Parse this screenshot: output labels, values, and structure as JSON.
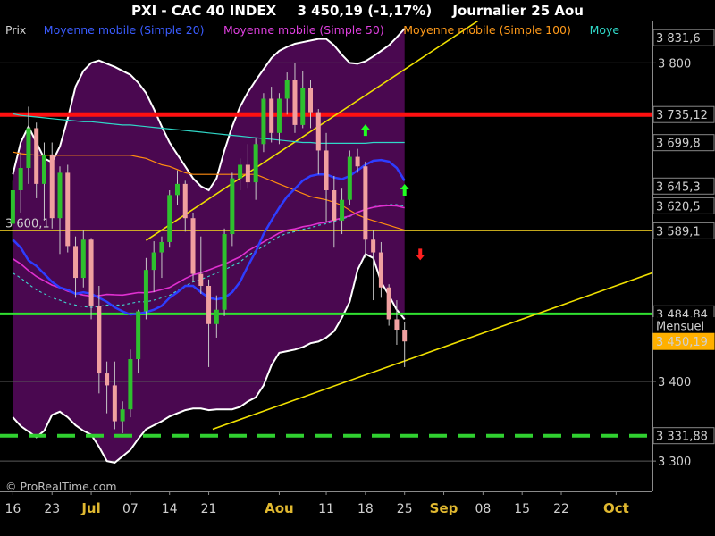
{
  "header": {
    "symbol": "PXI - CAC 40 INDEX",
    "last": "3 450,19 (-1,17%)",
    "period": "Journalier  25 Aou"
  },
  "legend": [
    {
      "label": "Prix",
      "color": "#cfcfcf"
    },
    {
      "label": "Moyenne mobile (Simple 20)",
      "color": "#3a5cff"
    },
    {
      "label": "Moyenne mobile (Simple 50)",
      "color": "#e040e0"
    },
    {
      "label": "Moyenne mobile (Simple 100)",
      "color": "#ff9a1a"
    },
    {
      "label": "Moye",
      "color": "#30d8c8"
    }
  ],
  "watermark": "© ProRealTime.com",
  "colors": {
    "up": "#2ec02e",
    "down": "#f0a0a0",
    "band_fill": "#4a0850",
    "band_line": "#ffffff",
    "resistance": "#ff1010",
    "support": "#30e030",
    "channel": "#f0e000",
    "sma20": "#2e3dff",
    "sma50": "#e030d0",
    "sma100": "#ff8c10",
    "sma200": "#30d8c8"
  },
  "chart_data": {
    "type": "candlestick",
    "instrument": "PXI - CAC 40 INDEX",
    "timeframe": "Journalier",
    "y_range": [
      3262,
      3852
    ],
    "y_ticks": [
      3300,
      3400,
      3800
    ],
    "x_tick_labels": [
      {
        "label": "16",
        "i": 0
      },
      {
        "label": "23",
        "i": 5
      },
      {
        "label": "Jul",
        "i": 10,
        "bold": true
      },
      {
        "label": "07",
        "i": 15
      },
      {
        "label": "14",
        "i": 20
      },
      {
        "label": "21",
        "i": 25
      },
      {
        "label": "Aou",
        "i": 34,
        "bold": true
      },
      {
        "label": "11",
        "i": 40
      },
      {
        "label": "18",
        "i": 45
      },
      {
        "label": "25",
        "i": 50
      },
      {
        "label": "Sep",
        "i": 55,
        "bold": true
      },
      {
        "label": "08",
        "i": 60
      },
      {
        "label": "15",
        "i": 65
      },
      {
        "label": "22",
        "i": 70
      },
      {
        "label": "Oct",
        "i": 77,
        "bold": true
      }
    ],
    "candles": [
      [
        3598,
        3652,
        3575,
        3640
      ],
      [
        3640,
        3688,
        3612,
        3668
      ],
      [
        3668,
        3745,
        3648,
        3718
      ],
      [
        3718,
        3725,
        3630,
        3648
      ],
      [
        3648,
        3700,
        3602,
        3685
      ],
      [
        3685,
        3700,
        3592,
        3605
      ],
      [
        3605,
        3670,
        3560,
        3662
      ],
      [
        3662,
        3672,
        3562,
        3570
      ],
      [
        3570,
        3582,
        3505,
        3530
      ],
      [
        3530,
        3590,
        3518,
        3578
      ],
      [
        3578,
        3580,
        3478,
        3495
      ],
      [
        3495,
        3520,
        3385,
        3410
      ],
      [
        3410,
        3425,
        3360,
        3395
      ],
      [
        3395,
        3425,
        3340,
        3350
      ],
      [
        3350,
        3375,
        3335,
        3365
      ],
      [
        3365,
        3440,
        3355,
        3428
      ],
      [
        3428,
        3490,
        3410,
        3488
      ],
      [
        3488,
        3555,
        3478,
        3540
      ],
      [
        3540,
        3576,
        3512,
        3562
      ],
      [
        3562,
        3582,
        3530,
        3575
      ],
      [
        3575,
        3640,
        3568,
        3634
      ],
      [
        3634,
        3665,
        3622,
        3648
      ],
      [
        3648,
        3652,
        3588,
        3605
      ],
      [
        3605,
        3612,
        3525,
        3535
      ],
      [
        3535,
        3582,
        3510,
        3520
      ],
      [
        3520,
        3528,
        3418,
        3472
      ],
      [
        3472,
        3508,
        3455,
        3490
      ],
      [
        3490,
        3592,
        3482,
        3585
      ],
      [
        3585,
        3662,
        3570,
        3655
      ],
      [
        3655,
        3680,
        3640,
        3672
      ],
      [
        3672,
        3698,
        3642,
        3650
      ],
      [
        3650,
        3705,
        3628,
        3698
      ],
      [
        3698,
        3762,
        3688,
        3755
      ],
      [
        3755,
        3770,
        3700,
        3712
      ],
      [
        3712,
        3762,
        3698,
        3755
      ],
      [
        3755,
        3788,
        3735,
        3778
      ],
      [
        3778,
        3800,
        3712,
        3722
      ],
      [
        3722,
        3790,
        3718,
        3768
      ],
      [
        3768,
        3778,
        3718,
        3738
      ],
      [
        3738,
        3742,
        3660,
        3690
      ],
      [
        3690,
        3712,
        3600,
        3640
      ],
      [
        3640,
        3658,
        3568,
        3602
      ],
      [
        3602,
        3642,
        3585,
        3628
      ],
      [
        3628,
        3690,
        3622,
        3682
      ],
      [
        3682,
        3692,
        3662,
        3670
      ],
      [
        3670,
        3676,
        3555,
        3578
      ],
      [
        3578,
        3590,
        3502,
        3562
      ],
      [
        3562,
        3575,
        3505,
        3518
      ],
      [
        3518,
        3522,
        3470,
        3478
      ],
      [
        3478,
        3502,
        3446,
        3465
      ],
      [
        3465,
        3475,
        3418,
        3450.19
      ]
    ],
    "sma20": [
      3578,
      3568,
      3552,
      3545,
      3535,
      3525,
      3518,
      3515,
      3510,
      3512,
      3510,
      3505,
      3500,
      3493,
      3488,
      3484,
      3485,
      3487,
      3490,
      3495,
      3505,
      3512,
      3520,
      3520,
      3512,
      3505,
      3503,
      3505,
      3512,
      3525,
      3545,
      3563,
      3585,
      3602,
      3618,
      3632,
      3642,
      3652,
      3658,
      3660,
      3660,
      3656,
      3654,
      3658,
      3665,
      3672,
      3677,
      3678,
      3676,
      3668,
      3652
    ],
    "sma50": [
      3536,
      3530,
      3522,
      3515,
      3510,
      3505,
      3502,
      3498,
      3496,
      3494,
      3493,
      3494,
      3496,
      3496,
      3496,
      3498,
      3500,
      3500,
      3502,
      3505,
      3508,
      3514,
      3520,
      3525,
      3528,
      3532,
      3536,
      3540,
      3545,
      3550,
      3558,
      3564,
      3570,
      3576,
      3582,
      3586,
      3588,
      3591,
      3593,
      3596,
      3598,
      3601,
      3604,
      3607,
      3612,
      3616,
      3619,
      3621,
      3622,
      3622,
      3620
    ],
    "sma100": [
      3688,
      3686,
      3685,
      3684,
      3684,
      3684,
      3684,
      3684,
      3684,
      3684,
      3684,
      3684,
      3684,
      3684,
      3684,
      3684,
      3682,
      3680,
      3676,
      3672,
      3670,
      3666,
      3662,
      3660,
      3660,
      3660,
      3660,
      3660,
      3660,
      3660,
      3660,
      3660,
      3656,
      3652,
      3648,
      3644,
      3640,
      3636,
      3632,
      3630,
      3628,
      3625,
      3621,
      3615,
      3609,
      3605,
      3602,
      3599,
      3596,
      3593,
      3590
    ],
    "sma200": [
      3736,
      3734,
      3733,
      3732,
      3731,
      3730,
      3729,
      3728,
      3727,
      3726,
      3726,
      3725,
      3724,
      3723,
      3722,
      3722,
      3721,
      3720,
      3719,
      3718,
      3717,
      3716,
      3715,
      3714,
      3713,
      3712,
      3711,
      3710,
      3709,
      3708,
      3707,
      3706,
      3705,
      3704,
      3703,
      3702,
      3701,
      3700,
      3700,
      3699,
      3699,
      3699,
      3699,
      3699,
      3699,
      3699,
      3700,
      3700,
      3700,
      3700,
      3700
    ],
    "band_upper": [
      3660,
      3700,
      3720,
      3700,
      3680,
      3675,
      3695,
      3730,
      3770,
      3790,
      3800,
      3803,
      3799,
      3795,
      3790,
      3785,
      3775,
      3762,
      3742,
      3720,
      3700,
      3685,
      3670,
      3655,
      3645,
      3640,
      3655,
      3690,
      3720,
      3745,
      3763,
      3778,
      3792,
      3806,
      3815,
      3820,
      3824,
      3826,
      3828,
      3830,
      3830,
      3822,
      3810,
      3800,
      3799,
      3802,
      3808,
      3815,
      3822,
      3832,
      3843
    ],
    "band_lower": [
      3355,
      3344,
      3337,
      3330,
      3338,
      3358,
      3362,
      3355,
      3345,
      3338,
      3333,
      3318,
      3300,
      3298,
      3306,
      3314,
      3328,
      3340,
      3345,
      3350,
      3356,
      3360,
      3364,
      3366,
      3366,
      3364,
      3365,
      3365,
      3365,
      3368,
      3375,
      3380,
      3395,
      3420,
      3436,
      3438,
      3440,
      3443,
      3448,
      3450,
      3455,
      3463,
      3480,
      3500,
      3540,
      3560,
      3555,
      3525,
      3508,
      3490,
      3478
    ],
    "horizontal_levels": [
      {
        "value": 3735.12,
        "label": "3 735,12",
        "color": "#ff1010",
        "style": "thick"
      },
      {
        "value": 3484.84,
        "label": "3 484,84",
        "color": "#30e030",
        "style": "solid",
        "note": "Mensuel"
      },
      {
        "value": 3331.88,
        "label": "3 331,88",
        "color": "#30d030",
        "style": "dashed"
      },
      {
        "value": 3589.1,
        "label": "3 600,1",
        "color": "#e0c020",
        "style": "thin"
      }
    ],
    "channel": {
      "upper": [
        [
          17,
          3577
        ],
        [
          80,
          3987
        ]
      ],
      "lower": [
        [
          25.5,
          3340
        ],
        [
          145,
          3758
        ]
      ]
    },
    "price_tags": [
      {
        "text": "3 831,6",
        "value": 3831.6,
        "fill": "#000",
        "color": "#fff",
        "border": "#888"
      },
      {
        "text": "3 735,12",
        "value": 3735.12,
        "fill": "#000",
        "color": "#ff4040",
        "border": "#888"
      },
      {
        "text": "3 699,8",
        "value": 3699.8,
        "fill": "#000",
        "color": "#40e8d8",
        "border": "#888"
      },
      {
        "text": "3 645,3",
        "value": 3645.3,
        "fill": "#000",
        "color": "#e040e0",
        "border": "#888"
      },
      {
        "text": "3 620,5",
        "value": 3620.5,
        "fill": "#000",
        "color": "#40e040",
        "border": "#888"
      },
      {
        "text": "3 589,1",
        "value": 3589.1,
        "fill": "#000",
        "color": "#e040e0",
        "border": "#888"
      },
      {
        "text": "3 484,84",
        "value": 3484.84,
        "fill": "#000",
        "color": "#60ff60",
        "border": "#888"
      },
      {
        "text": "Mensuel",
        "value": 3470,
        "fill": "#000",
        "color": "#60ff60",
        "border": "#000"
      },
      {
        "text": "3 450,19",
        "value": 3450.19,
        "fill": "#ffb000",
        "color": "#000",
        "border": "#ffb000"
      },
      {
        "text": "3 331,88",
        "value": 3331.88,
        "fill": "#000",
        "color": "#60ff60",
        "border": "#888"
      }
    ],
    "arrows": [
      {
        "i": 45,
        "value": 3715,
        "dir": "up",
        "color": "#20ff20"
      },
      {
        "i": 52,
        "value": 3560,
        "dir": "down",
        "color": "#ff2020"
      },
      {
        "i": 50,
        "value": 3640,
        "dir": "up",
        "color": "#20ff20"
      }
    ]
  }
}
